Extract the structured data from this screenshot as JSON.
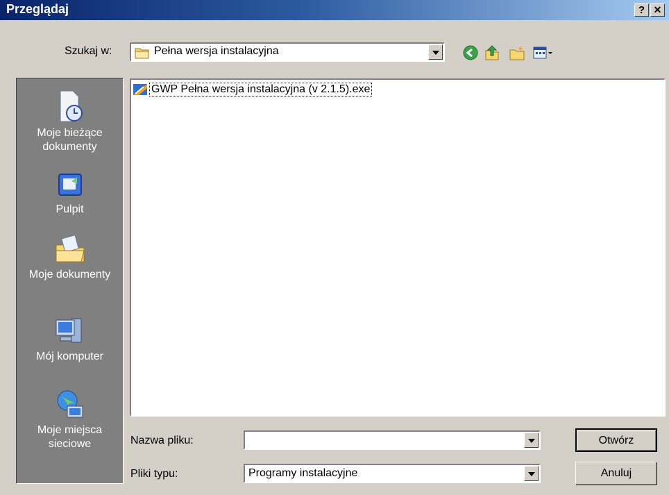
{
  "window": {
    "title": "Przeglądaj",
    "help_btn": "?",
    "close_btn": "✕"
  },
  "lookin": {
    "label": "Szukaj w:",
    "value": "Pełna wersja instalacyjna"
  },
  "toolbar": {
    "back": "back-icon",
    "up": "up-folder-icon",
    "newfolder": "new-folder-icon",
    "views": "views-menu-icon"
  },
  "places": [
    {
      "label": "Moje bieżące dokumenty",
      "icon": "recent-documents-icon"
    },
    {
      "label": "Pulpit",
      "icon": "desktop-icon"
    },
    {
      "label": "Moje dokumenty",
      "icon": "my-documents-icon"
    },
    {
      "label": "Mój komputer",
      "icon": "my-computer-icon"
    },
    {
      "label": "Moje miejsca sieciowe",
      "icon": "network-places-icon"
    }
  ],
  "files": [
    {
      "name": "GWP Pełna wersja instalacyjna (v 2.1.5).exe",
      "icon": "installer-icon"
    }
  ],
  "filename": {
    "label": "Nazwa pliku:",
    "value": ""
  },
  "filetype": {
    "label": "Pliki typu:",
    "value": "Programy instalacyjne"
  },
  "buttons": {
    "open": "Otwórz",
    "cancel": "Anuluj"
  },
  "colors": {
    "titlebar": "#0a246a",
    "dialog": "#d4d0c8",
    "places_bg": "#808080"
  }
}
